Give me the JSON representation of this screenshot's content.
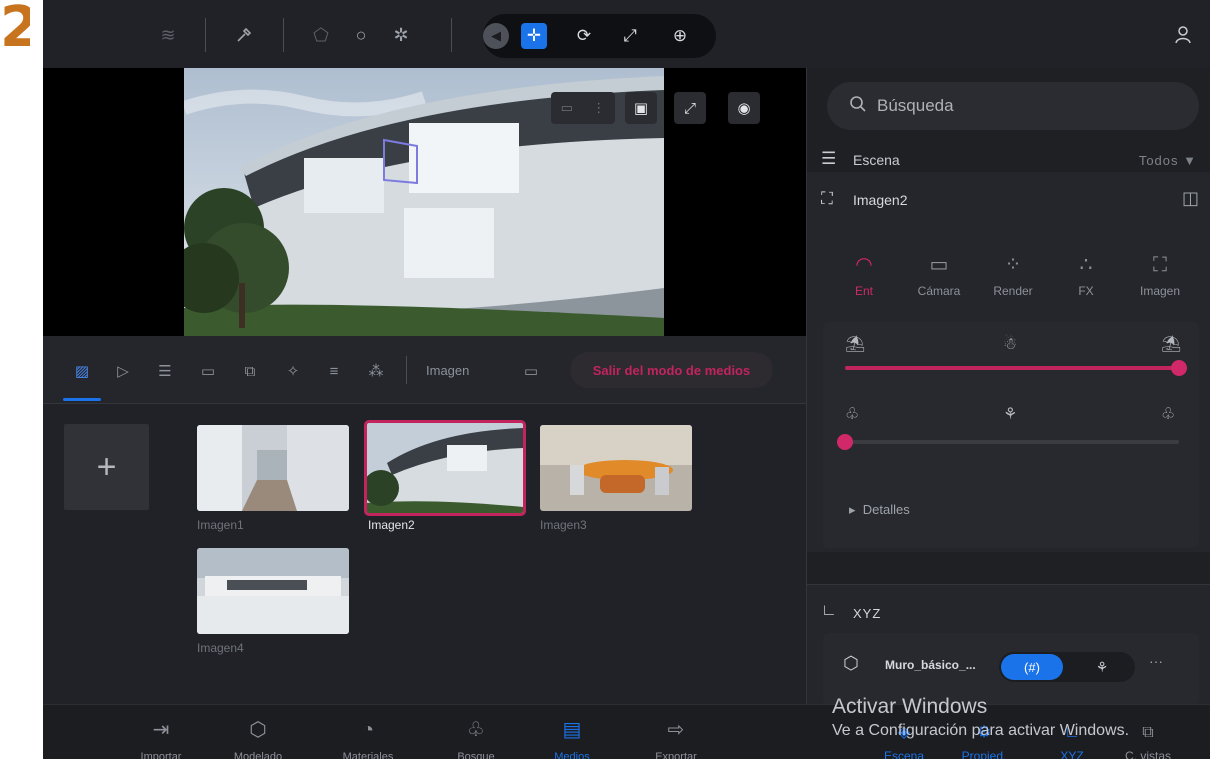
{
  "step_number": "2",
  "toolbar": {
    "left_icons": [
      "layers-icon",
      "eyedropper-icon",
      "paint-bucket-icon",
      "circle-tool-icon",
      "pattern-tool-icon"
    ],
    "transform_icons": [
      "back-arrow-icon",
      "move-icon",
      "rotate-icon",
      "scale-icon",
      "globe-icon"
    ],
    "active_transform": "move-icon",
    "user_icon": "user-settings-icon"
  },
  "viewport": {
    "controls": [
      "camera-icon",
      "more-icon",
      "picture-in-picture-icon",
      "expand-icon",
      "eye-icon"
    ]
  },
  "media_tabs": {
    "icons": [
      "image-tab-icon",
      "video-tab-icon",
      "sun-study-icon",
      "panorama-icon",
      "stack-icon",
      "walker-icon",
      "list-icon",
      "nodes-icon"
    ],
    "active": "image-tab-icon",
    "label": "Imagen",
    "exit_button": "Salir del modo de medios"
  },
  "gallery": {
    "add_symbol": "+",
    "items": [
      {
        "label": "Imagen1",
        "selected": false
      },
      {
        "label": "Imagen2",
        "selected": true
      },
      {
        "label": "Imagen3",
        "selected": false
      },
      {
        "label": "Imagen4",
        "selected": false
      }
    ]
  },
  "bottom_nav": {
    "items": [
      {
        "label": "Importar",
        "icon": "import-icon"
      },
      {
        "label": "Modelado",
        "icon": "cube-icon"
      },
      {
        "label": "Materiales",
        "icon": "material-icon"
      },
      {
        "label": "Bosque",
        "icon": "tree-icon"
      },
      {
        "label": "Medios",
        "icon": "clapperboard-icon",
        "active": true
      },
      {
        "label": "Exportar",
        "icon": "export-icon"
      }
    ],
    "right_items": [
      {
        "label": "Escena",
        "icon": "scene-icon",
        "active": true
      },
      {
        "label": "Propied.",
        "icon": "properties-icon",
        "active": true
      },
      {
        "label": "XYZ",
        "icon": "axes-icon",
        "active": true
      },
      {
        "label": "C. vistas",
        "icon": "views-icon",
        "active": false
      }
    ]
  },
  "right_panel": {
    "search_placeholder": "Búsqueda",
    "scene_label": "Escena",
    "scene_filter": "Todos ▼",
    "object_name": "Imagen2",
    "sub_tabs": [
      {
        "label": "Ent",
        "icon": "environment-icon",
        "active": true
      },
      {
        "label": "Cámara",
        "icon": "camera-icon",
        "active": false
      },
      {
        "label": "Render",
        "icon": "render-icon",
        "active": false
      },
      {
        "label": "FX",
        "icon": "fx-icon",
        "active": false
      },
      {
        "label": "Imagen",
        "icon": "image-icon",
        "active": false
      }
    ],
    "sliders": [
      {
        "name": "sun-position",
        "value": 1.0
      },
      {
        "name": "tree-density",
        "value": 0.0
      }
    ],
    "details_label": "Detalles",
    "xyz_label": "XYZ",
    "xyz_object": "Muro_básico_...",
    "xyz_more": "···"
  },
  "watermark": {
    "title": "Activar Windows",
    "subtitle": "Ve a Configuración para activar Windows."
  },
  "colors": {
    "accent_blue": "#1a73e8",
    "accent_pink": "#c2245e",
    "background": "#24262c",
    "step_orange": "#c8741f"
  }
}
